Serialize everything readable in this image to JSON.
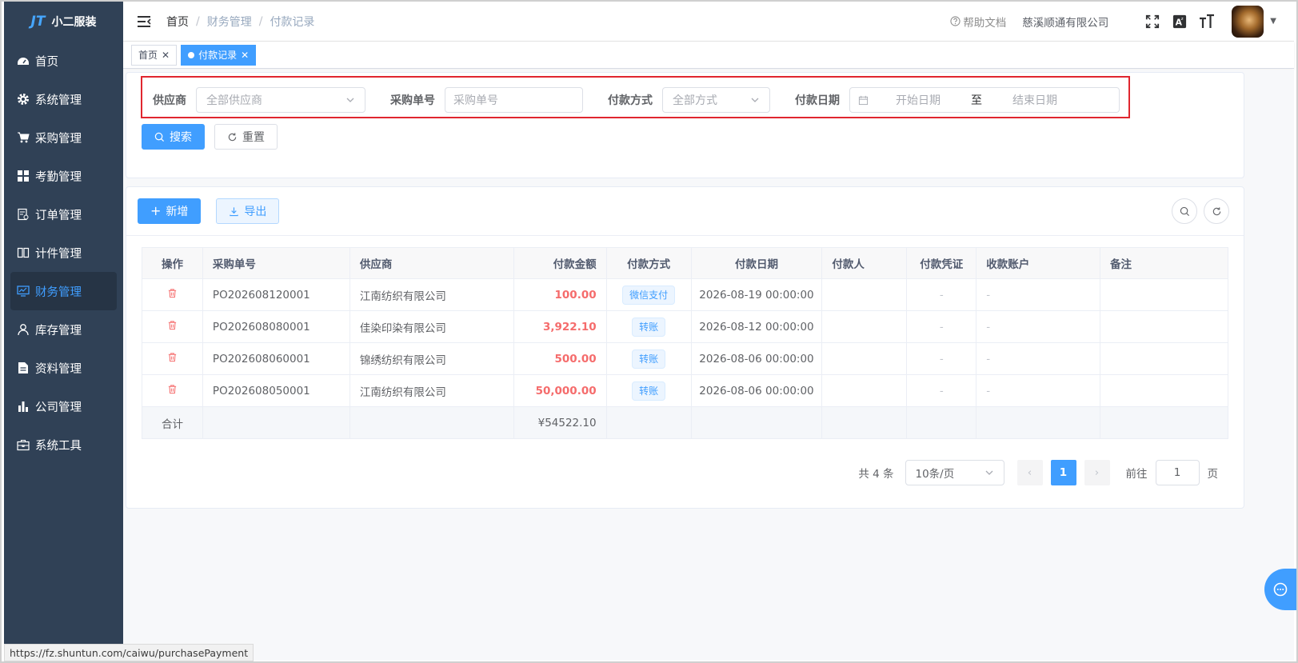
{
  "sidebar": {
    "logo_mark": "JT",
    "logo_text": "小二服装",
    "items": [
      {
        "label": "首页",
        "icon": "dashboard-icon"
      },
      {
        "label": "系统管理",
        "icon": "gear-icon"
      },
      {
        "label": "采购管理",
        "icon": "cart-icon"
      },
      {
        "label": "考勤管理",
        "icon": "grid-icon"
      },
      {
        "label": "订单管理",
        "icon": "order-icon"
      },
      {
        "label": "计件管理",
        "icon": "book-icon"
      },
      {
        "label": "财务管理",
        "icon": "monitor-icon",
        "active": true
      },
      {
        "label": "库存管理",
        "icon": "user-icon"
      },
      {
        "label": "资料管理",
        "icon": "document-icon"
      },
      {
        "label": "公司管理",
        "icon": "bar-chart-icon"
      },
      {
        "label": "系统工具",
        "icon": "toolbox-icon"
      }
    ]
  },
  "header": {
    "breadcrumb": [
      "首页",
      "财务管理",
      "付款记录"
    ],
    "help": "帮助文档",
    "company": "慈溪顺通有限公司"
  },
  "tags": [
    {
      "label": "首页",
      "active": false
    },
    {
      "label": "付款记录",
      "active": true
    }
  ],
  "search": {
    "supplier_label": "供应商",
    "supplier_placeholder": "全部供应商",
    "po_label": "采购单号",
    "po_placeholder": "采购单号",
    "method_label": "付款方式",
    "method_placeholder": "全部方式",
    "date_label": "付款日期",
    "date_start": "开始日期",
    "date_sep": "至",
    "date_end": "结束日期",
    "search_btn": "搜索",
    "reset_btn": "重置"
  },
  "toolbar": {
    "add": "新增",
    "export": "导出"
  },
  "table": {
    "headers": [
      "操作",
      "采购单号",
      "供应商",
      "付款金额",
      "付款方式",
      "付款日期",
      "付款人",
      "付款凭证",
      "收款账户",
      "备注"
    ],
    "rows": [
      {
        "po": "PO202608120001",
        "supplier": "江南纺织有限公司",
        "amount": "100.00",
        "method": "微信支付",
        "date": "2026-08-19 00:00:00",
        "payer": "",
        "voucher": "-",
        "account": "-",
        "remark": ""
      },
      {
        "po": "PO202608080001",
        "supplier": "佳染印染有限公司",
        "amount": "3,922.10",
        "method": "转账",
        "date": "2026-08-12 00:00:00",
        "payer": "",
        "voucher": "-",
        "account": "-",
        "remark": ""
      },
      {
        "po": "PO202608060001",
        "supplier": "锦绣纺织有限公司",
        "amount": "500.00",
        "method": "转账",
        "date": "2026-08-06 00:00:00",
        "payer": "",
        "voucher": "-",
        "account": "-",
        "remark": ""
      },
      {
        "po": "PO202608050001",
        "supplier": "江南纺织有限公司",
        "amount": "50,000.00",
        "method": "转账",
        "date": "2026-08-06 00:00:00",
        "payer": "",
        "voucher": "-",
        "account": "-",
        "remark": ""
      }
    ],
    "summary_label": "合计",
    "summary_amount": "¥54522.10"
  },
  "pagination": {
    "total": "共 4 条",
    "page_size": "10条/页",
    "current": "1",
    "goto_label": "前往",
    "goto_value": "1",
    "page_unit": "页"
  },
  "status_url": "https://fz.shuntun.com/caiwu/purchasePayment",
  "colors": {
    "primary": "#409eff",
    "sidebar": "#304156",
    "amount": "#f56c6c",
    "highlight": "#e0262f"
  }
}
